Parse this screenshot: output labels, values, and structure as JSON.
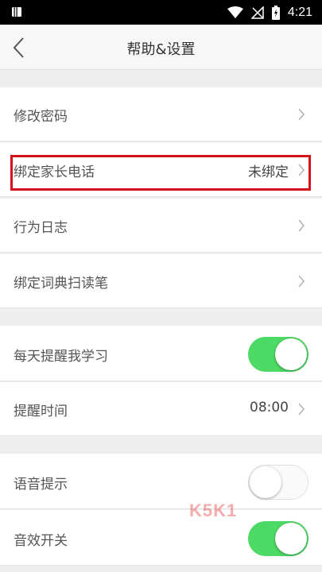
{
  "status_bar": {
    "time": "4:21"
  },
  "nav": {
    "title": "帮助&设置"
  },
  "account_section": [
    {
      "label": "修改密码"
    },
    {
      "label": "绑定家长电话",
      "value": "未绑定"
    },
    {
      "label": "行为日志"
    },
    {
      "label": "绑定词典扫读笔"
    }
  ],
  "reminder_section": {
    "daily_reminder": {
      "label": "每天提醒我学习",
      "enabled": true
    },
    "reminder_time": {
      "label": "提醒时间",
      "value": "08:00"
    }
  },
  "sound_section": {
    "voice_prompt": {
      "label": "语音提示",
      "enabled": false
    },
    "sound_effects": {
      "label": "音效开关",
      "enabled": true
    }
  },
  "watermark": {
    "text": "K5K1"
  },
  "colors": {
    "toggle_on": "#4cd964",
    "highlight": "#d6121a"
  }
}
